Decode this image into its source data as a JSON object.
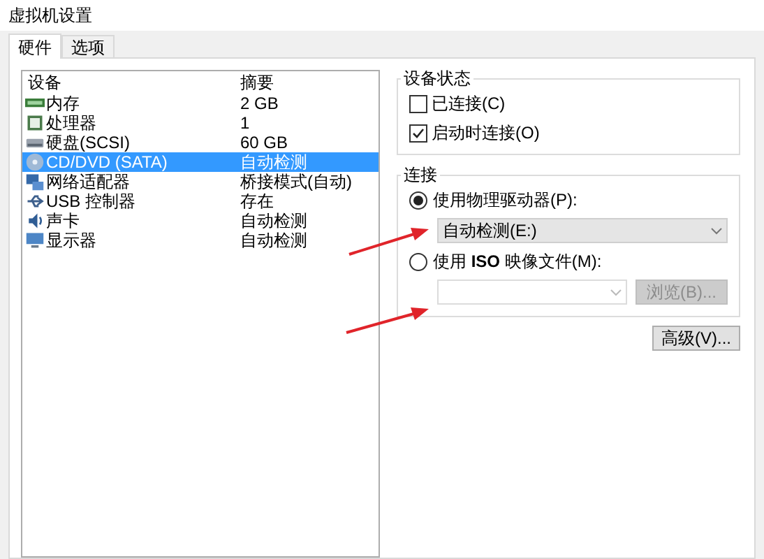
{
  "window": {
    "title": "虚拟机设置"
  },
  "tabs": [
    {
      "label": "硬件",
      "selected": true
    },
    {
      "label": "选项",
      "selected": false
    }
  ],
  "device_list": {
    "columns": [
      "设备",
      "摘要"
    ],
    "rows": [
      {
        "kind": "memory",
        "device": "内存",
        "summary": "2 GB",
        "selected": false
      },
      {
        "kind": "cpu",
        "device": "处理器",
        "summary": "1",
        "selected": false
      },
      {
        "kind": "disk",
        "device": "硬盘(SCSI)",
        "summary": "60 GB",
        "selected": false
      },
      {
        "kind": "cd",
        "device": "CD/DVD (SATA)",
        "summary": "自动检测",
        "selected": true
      },
      {
        "kind": "network",
        "device": "网络适配器",
        "summary": "桥接模式(自动)",
        "selected": false
      },
      {
        "kind": "usb",
        "device": "USB 控制器",
        "summary": "存在",
        "selected": false
      },
      {
        "kind": "sound",
        "device": "声卡",
        "summary": "自动检测",
        "selected": false
      },
      {
        "kind": "display",
        "device": "显示器",
        "summary": "自动检测",
        "selected": false
      }
    ]
  },
  "device_status": {
    "title": "设备状态",
    "checkboxes": [
      {
        "label": "已连接(C)",
        "checked": false
      },
      {
        "label": "启动时连接(O)",
        "checked": true
      }
    ]
  },
  "connection": {
    "title": "连接",
    "options": [
      {
        "label": "使用物理驱动器(P):",
        "selected": true,
        "dropdown": {
          "value": "自动检测(E:)",
          "disabled": false
        }
      },
      {
        "label": "使用 **ISO** 映像文件(M):",
        "selected": false,
        "dropdown": {
          "disabled": true
        },
        "browse_button": {
          "label": "浏览(B)...",
          "disabled": true
        }
      }
    ]
  },
  "advanced_button": {
    "label": "高级(V)..."
  }
}
